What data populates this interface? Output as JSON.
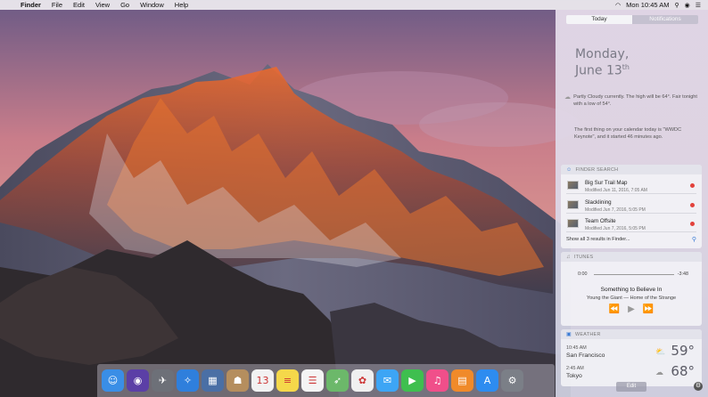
{
  "menubar": {
    "app_name": "Finder",
    "items": [
      "File",
      "Edit",
      "View",
      "Go",
      "Window",
      "Help"
    ],
    "clock": "Mon 10:45 AM"
  },
  "notification_center": {
    "tabs": {
      "today": "Today",
      "notifications": "Notifications"
    },
    "date_line_1": "Monday,",
    "date_line_2": "June 13",
    "date_suffix": "th",
    "weather_summary": "Partly Cloudy currently. The high will be 64°. Fair tonight with a low of 54°.",
    "calendar_summary": "The first thing on your calendar today is \"WWDC Keynote\", and it started 46 minutes ago.",
    "finder_search": {
      "title": "FINDER SEARCH",
      "results": [
        {
          "name": "Big Sur Trail Map",
          "modified": "Modified Jun 11, 2016, 7:05 AM"
        },
        {
          "name": "Slacklining",
          "modified": "Modified Jun 7, 2016, 5:05 PM"
        },
        {
          "name": "Team Offsite",
          "modified": "Modified Jun 7, 2016, 5:05 PM"
        }
      ],
      "show_all": "Show all 3 results in Finder...",
      "tag_color": "#e2413b"
    },
    "itunes": {
      "title": "ITUNES",
      "elapsed": "0:00",
      "remaining": "-3:48",
      "progress": 0,
      "song": "Something to Believe In",
      "artist_album": "Young the Giant — Home of the Strange"
    },
    "weather": {
      "title": "WEATHER",
      "cities": [
        {
          "time": "10:45 AM",
          "city": "San Francisco",
          "temp": "59°",
          "icon": "partly-cloudy-icon"
        },
        {
          "time": "2:45 AM",
          "city": "Tokyo",
          "temp": "68°",
          "icon": "cloudy-icon"
        }
      ]
    },
    "edit_label": "Edit"
  },
  "dock": {
    "apps": [
      {
        "name": "finder",
        "glyph": "☺",
        "color": "#3a8ee6"
      },
      {
        "name": "siri",
        "glyph": "◉",
        "color": "#5b3fa6"
      },
      {
        "name": "launchpad",
        "glyph": "✈",
        "color": "#6d7078"
      },
      {
        "name": "safari",
        "glyph": "✧",
        "color": "#2f7fdc"
      },
      {
        "name": "preview",
        "glyph": "▦",
        "color": "#4a6fa5"
      },
      {
        "name": "contacts",
        "glyph": "☗",
        "color": "#b58e5e"
      },
      {
        "name": "calendar",
        "glyph": "13",
        "color": "#f2f2f2"
      },
      {
        "name": "notes",
        "glyph": "≡",
        "color": "#f5d84a"
      },
      {
        "name": "reminders",
        "glyph": "☰",
        "color": "#f4f4f4"
      },
      {
        "name": "maps",
        "glyph": "➶",
        "color": "#6cb86a"
      },
      {
        "name": "photos",
        "glyph": "✿",
        "color": "#f0f0f0"
      },
      {
        "name": "messages",
        "glyph": "✉",
        "color": "#3da5f5"
      },
      {
        "name": "facetime",
        "glyph": "▶",
        "color": "#3fbf4f"
      },
      {
        "name": "itunes",
        "glyph": "♫",
        "color": "#f04f8a"
      },
      {
        "name": "ibooks",
        "glyph": "▤",
        "color": "#f08a2a"
      },
      {
        "name": "app-store",
        "glyph": "A",
        "color": "#2d8cf0"
      },
      {
        "name": "system-preferences",
        "glyph": "⚙",
        "color": "#7b7f87"
      }
    ]
  }
}
